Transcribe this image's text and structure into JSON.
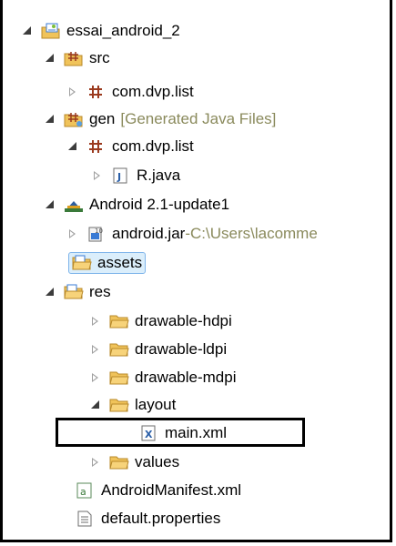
{
  "tree": {
    "project": "essai_android_2",
    "src": "src",
    "src_pkg": "com.dvp.list",
    "gen": "gen",
    "gen_decoration": "[Generated Java Files]",
    "gen_pkg": "com.dvp.list",
    "r_java": "R.java",
    "android_lib": "Android 2.1-update1",
    "android_jar": "android.jar",
    "android_jar_sep": " - ",
    "android_jar_path": "C:\\Users\\lacomme",
    "assets": "assets",
    "res": "res",
    "drawable_hdpi": "drawable-hdpi",
    "drawable_ldpi": "drawable-ldpi",
    "drawable_mdpi": "drawable-mdpi",
    "layout": "layout",
    "main_xml": "main.xml",
    "values": "values",
    "manifest": "AndroidManifest.xml",
    "default_properties": "default.properties"
  },
  "colors": {
    "folder": "#f0c35a",
    "package": "#9b3a1e",
    "selection": "#dbeefb",
    "decoration": "#8a8a5c"
  }
}
